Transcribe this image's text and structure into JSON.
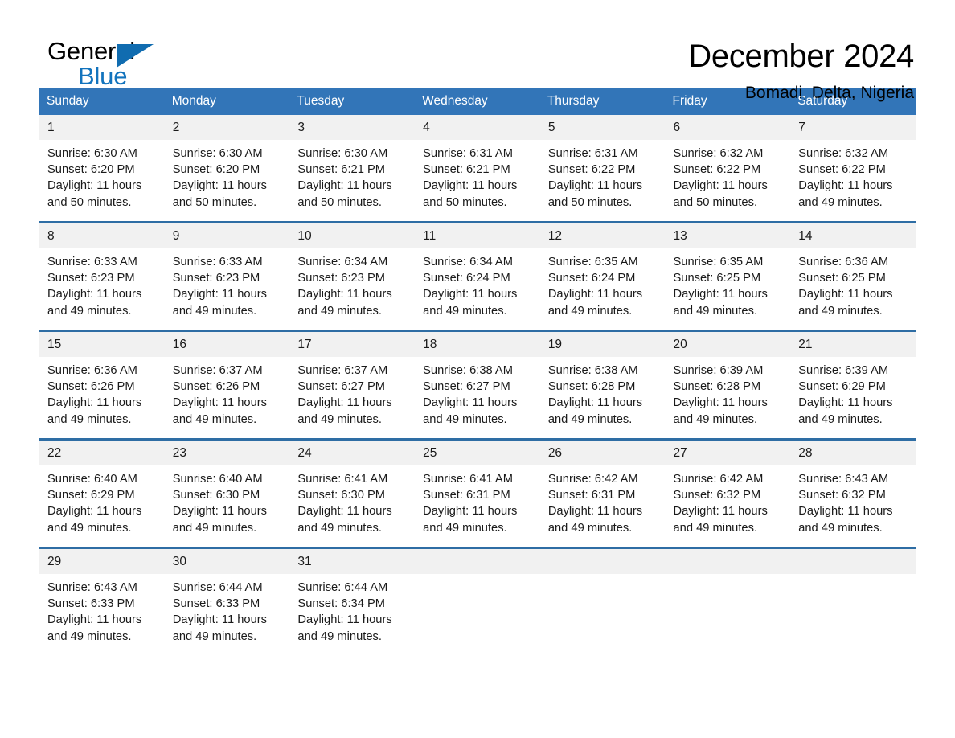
{
  "brand": {
    "name_top": "General",
    "name_bottom": "Blue",
    "flag_icon": "triangle-flag-icon",
    "accent_color": "#1273bd"
  },
  "header": {
    "title": "December 2024",
    "subtitle": "Bomadi, Delta, Nigeria"
  },
  "theme": {
    "header_blue": "#3275b8",
    "rule_blue": "#2e6da4",
    "daynum_background": "#f1f1f1"
  },
  "calendar": {
    "weekday_headers": [
      "Sunday",
      "Monday",
      "Tuesday",
      "Wednesday",
      "Thursday",
      "Friday",
      "Saturday"
    ],
    "weeks": [
      [
        {
          "day": "1",
          "sunrise": "Sunrise: 6:30 AM",
          "sunset": "Sunset: 6:20 PM",
          "daylight_line1": "Daylight: 11 hours",
          "daylight_line2": "and 50 minutes."
        },
        {
          "day": "2",
          "sunrise": "Sunrise: 6:30 AM",
          "sunset": "Sunset: 6:20 PM",
          "daylight_line1": "Daylight: 11 hours",
          "daylight_line2": "and 50 minutes."
        },
        {
          "day": "3",
          "sunrise": "Sunrise: 6:30 AM",
          "sunset": "Sunset: 6:21 PM",
          "daylight_line1": "Daylight: 11 hours",
          "daylight_line2": "and 50 minutes."
        },
        {
          "day": "4",
          "sunrise": "Sunrise: 6:31 AM",
          "sunset": "Sunset: 6:21 PM",
          "daylight_line1": "Daylight: 11 hours",
          "daylight_line2": "and 50 minutes."
        },
        {
          "day": "5",
          "sunrise": "Sunrise: 6:31 AM",
          "sunset": "Sunset: 6:22 PM",
          "daylight_line1": "Daylight: 11 hours",
          "daylight_line2": "and 50 minutes."
        },
        {
          "day": "6",
          "sunrise": "Sunrise: 6:32 AM",
          "sunset": "Sunset: 6:22 PM",
          "daylight_line1": "Daylight: 11 hours",
          "daylight_line2": "and 50 minutes."
        },
        {
          "day": "7",
          "sunrise": "Sunrise: 6:32 AM",
          "sunset": "Sunset: 6:22 PM",
          "daylight_line1": "Daylight: 11 hours",
          "daylight_line2": "and 49 minutes."
        }
      ],
      [
        {
          "day": "8",
          "sunrise": "Sunrise: 6:33 AM",
          "sunset": "Sunset: 6:23 PM",
          "daylight_line1": "Daylight: 11 hours",
          "daylight_line2": "and 49 minutes."
        },
        {
          "day": "9",
          "sunrise": "Sunrise: 6:33 AM",
          "sunset": "Sunset: 6:23 PM",
          "daylight_line1": "Daylight: 11 hours",
          "daylight_line2": "and 49 minutes."
        },
        {
          "day": "10",
          "sunrise": "Sunrise: 6:34 AM",
          "sunset": "Sunset: 6:23 PM",
          "daylight_line1": "Daylight: 11 hours",
          "daylight_line2": "and 49 minutes."
        },
        {
          "day": "11",
          "sunrise": "Sunrise: 6:34 AM",
          "sunset": "Sunset: 6:24 PM",
          "daylight_line1": "Daylight: 11 hours",
          "daylight_line2": "and 49 minutes."
        },
        {
          "day": "12",
          "sunrise": "Sunrise: 6:35 AM",
          "sunset": "Sunset: 6:24 PM",
          "daylight_line1": "Daylight: 11 hours",
          "daylight_line2": "and 49 minutes."
        },
        {
          "day": "13",
          "sunrise": "Sunrise: 6:35 AM",
          "sunset": "Sunset: 6:25 PM",
          "daylight_line1": "Daylight: 11 hours",
          "daylight_line2": "and 49 minutes."
        },
        {
          "day": "14",
          "sunrise": "Sunrise: 6:36 AM",
          "sunset": "Sunset: 6:25 PM",
          "daylight_line1": "Daylight: 11 hours",
          "daylight_line2": "and 49 minutes."
        }
      ],
      [
        {
          "day": "15",
          "sunrise": "Sunrise: 6:36 AM",
          "sunset": "Sunset: 6:26 PM",
          "daylight_line1": "Daylight: 11 hours",
          "daylight_line2": "and 49 minutes."
        },
        {
          "day": "16",
          "sunrise": "Sunrise: 6:37 AM",
          "sunset": "Sunset: 6:26 PM",
          "daylight_line1": "Daylight: 11 hours",
          "daylight_line2": "and 49 minutes."
        },
        {
          "day": "17",
          "sunrise": "Sunrise: 6:37 AM",
          "sunset": "Sunset: 6:27 PM",
          "daylight_line1": "Daylight: 11 hours",
          "daylight_line2": "and 49 minutes."
        },
        {
          "day": "18",
          "sunrise": "Sunrise: 6:38 AM",
          "sunset": "Sunset: 6:27 PM",
          "daylight_line1": "Daylight: 11 hours",
          "daylight_line2": "and 49 minutes."
        },
        {
          "day": "19",
          "sunrise": "Sunrise: 6:38 AM",
          "sunset": "Sunset: 6:28 PM",
          "daylight_line1": "Daylight: 11 hours",
          "daylight_line2": "and 49 minutes."
        },
        {
          "day": "20",
          "sunrise": "Sunrise: 6:39 AM",
          "sunset": "Sunset: 6:28 PM",
          "daylight_line1": "Daylight: 11 hours",
          "daylight_line2": "and 49 minutes."
        },
        {
          "day": "21",
          "sunrise": "Sunrise: 6:39 AM",
          "sunset": "Sunset: 6:29 PM",
          "daylight_line1": "Daylight: 11 hours",
          "daylight_line2": "and 49 minutes."
        }
      ],
      [
        {
          "day": "22",
          "sunrise": "Sunrise: 6:40 AM",
          "sunset": "Sunset: 6:29 PM",
          "daylight_line1": "Daylight: 11 hours",
          "daylight_line2": "and 49 minutes."
        },
        {
          "day": "23",
          "sunrise": "Sunrise: 6:40 AM",
          "sunset": "Sunset: 6:30 PM",
          "daylight_line1": "Daylight: 11 hours",
          "daylight_line2": "and 49 minutes."
        },
        {
          "day": "24",
          "sunrise": "Sunrise: 6:41 AM",
          "sunset": "Sunset: 6:30 PM",
          "daylight_line1": "Daylight: 11 hours",
          "daylight_line2": "and 49 minutes."
        },
        {
          "day": "25",
          "sunrise": "Sunrise: 6:41 AM",
          "sunset": "Sunset: 6:31 PM",
          "daylight_line1": "Daylight: 11 hours",
          "daylight_line2": "and 49 minutes."
        },
        {
          "day": "26",
          "sunrise": "Sunrise: 6:42 AM",
          "sunset": "Sunset: 6:31 PM",
          "daylight_line1": "Daylight: 11 hours",
          "daylight_line2": "and 49 minutes."
        },
        {
          "day": "27",
          "sunrise": "Sunrise: 6:42 AM",
          "sunset": "Sunset: 6:32 PM",
          "daylight_line1": "Daylight: 11 hours",
          "daylight_line2": "and 49 minutes."
        },
        {
          "day": "28",
          "sunrise": "Sunrise: 6:43 AM",
          "sunset": "Sunset: 6:32 PM",
          "daylight_line1": "Daylight: 11 hours",
          "daylight_line2": "and 49 minutes."
        }
      ],
      [
        {
          "day": "29",
          "sunrise": "Sunrise: 6:43 AM",
          "sunset": "Sunset: 6:33 PM",
          "daylight_line1": "Daylight: 11 hours",
          "daylight_line2": "and 49 minutes."
        },
        {
          "day": "30",
          "sunrise": "Sunrise: 6:44 AM",
          "sunset": "Sunset: 6:33 PM",
          "daylight_line1": "Daylight: 11 hours",
          "daylight_line2": "and 49 minutes."
        },
        {
          "day": "31",
          "sunrise": "Sunrise: 6:44 AM",
          "sunset": "Sunset: 6:34 PM",
          "daylight_line1": "Daylight: 11 hours",
          "daylight_line2": "and 49 minutes."
        },
        {
          "day": "",
          "sunrise": "",
          "sunset": "",
          "daylight_line1": "",
          "daylight_line2": ""
        },
        {
          "day": "",
          "sunrise": "",
          "sunset": "",
          "daylight_line1": "",
          "daylight_line2": ""
        },
        {
          "day": "",
          "sunrise": "",
          "sunset": "",
          "daylight_line1": "",
          "daylight_line2": ""
        },
        {
          "day": "",
          "sunrise": "",
          "sunset": "",
          "daylight_line1": "",
          "daylight_line2": ""
        }
      ]
    ]
  }
}
